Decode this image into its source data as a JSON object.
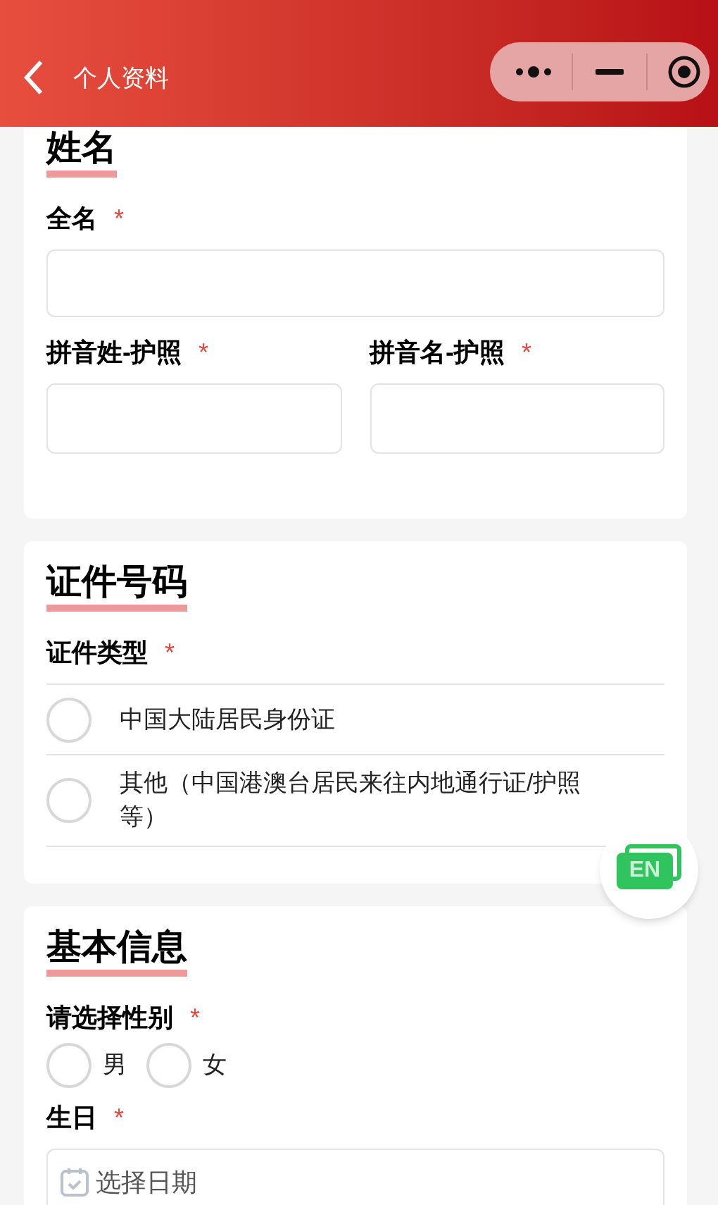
{
  "header": {
    "title": "个人资料"
  },
  "sections": [
    {
      "title": "姓名",
      "fields": [
        {
          "kind": "text",
          "label": "全名",
          "required": "*"
        },
        {
          "kind": "text-pair",
          "items": [
            {
              "label": "拼音姓-护照",
              "required": "*"
            },
            {
              "label": "拼音名-护照",
              "required": "*"
            }
          ]
        }
      ]
    },
    {
      "title": "证件号码",
      "fields": [
        {
          "kind": "radio-list",
          "label": "证件类型",
          "required": "*",
          "options": [
            {
              "label": "中国大陆居民身份证",
              "selected": false
            },
            {
              "label": "其他（中国港澳台居民来往内地通行证/护照等）",
              "selected": false
            }
          ]
        }
      ]
    },
    {
      "title": "基本信息",
      "fields": [
        {
          "kind": "radio-inline",
          "label": "请选择性别",
          "required": "*",
          "options": [
            {
              "label": "男",
              "selected": false
            },
            {
              "label": "女",
              "selected": false
            }
          ]
        },
        {
          "kind": "date",
          "label": "生日",
          "required": "*",
          "placeholder": "选择日期"
        }
      ]
    }
  ],
  "language_button": {
    "label": "EN"
  }
}
